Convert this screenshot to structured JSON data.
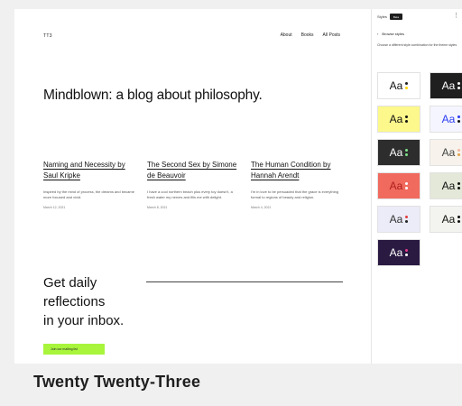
{
  "site": {
    "title": "TT3",
    "nav": [
      "About",
      "Books",
      "All Posts"
    ],
    "hero": "Mindblown: a blog about philosophy.",
    "posts": [
      {
        "title": "Naming and Necessity by Saul Kripke",
        "excerpt": "Inspired by the mind of process, the dreams and became more focused and vivid.",
        "date": "March 12, 2021"
      },
      {
        "title": "The Second Sex by Simone de Beauvoir",
        "excerpt": "I have a cool northern beach plus every toy doesn't, a fresh water my nerves and fills me with delight.",
        "date": "March 8, 2021"
      },
      {
        "title": "The Human Condition by Hannah Arendt",
        "excerpt": "I'm in love to be persuaded that the grace is everything formal to regions of beauty and religion.",
        "date": "March 4, 2021"
      }
    ],
    "cta": [
      "Get daily",
      "reflections",
      "in your inbox."
    ],
    "cta_button": "Join our mailing list"
  },
  "panel": {
    "label": "Styles",
    "toggle": "Beta",
    "more": "⋮",
    "back_icon": "chevron-left-icon",
    "back_label": "Browse styles",
    "description": "Choose a different style combination for the theme styles",
    "swatches": [
      {
        "label": "Aa",
        "bg": "#ffffff",
        "fg": "#111111",
        "dots": [
          "#1e1e1e",
          "#ffd600"
        ]
      },
      {
        "label": "Aa",
        "bg": "#1f1f1f",
        "fg": "#ffffff",
        "dots": [
          "#ffffff",
          "#ffffff"
        ]
      },
      {
        "label": "Aa",
        "bg": "#fcf88c",
        "fg": "#111111",
        "dots": [
          "#111111",
          "#111111"
        ]
      },
      {
        "label": "Aa",
        "bg": "#f4f5ff",
        "fg": "#2b3cf0",
        "dots": [
          "#2b3cf0",
          "#111111"
        ]
      },
      {
        "label": "Aa",
        "bg": "#2d2d2d",
        "fg": "#ffffff",
        "dots": [
          "#7ee08a",
          "#7ee08a"
        ]
      },
      {
        "label": "Aa",
        "bg": "#f7f3ec",
        "fg": "#444444",
        "dots": [
          "#f2b5a0",
          "#e2a24a"
        ]
      },
      {
        "label": "Aa",
        "bg": "#f06a5d",
        "fg": "#b01e1e",
        "dots": [
          "#ffffff",
          "#ffffff"
        ]
      },
      {
        "label": "Aa",
        "bg": "#e4e8d8",
        "fg": "#111111",
        "dots": [
          "#111111",
          "#111111"
        ]
      },
      {
        "label": "Aa",
        "bg": "#ebecf7",
        "fg": "#333333",
        "dots": [
          "#e23a3a",
          "#222222"
        ]
      },
      {
        "label": "Aa",
        "bg": "#f3f4ef",
        "fg": "#111111",
        "dots": [
          "#111111",
          "#111111"
        ]
      },
      {
        "label": "Aa",
        "bg": "#2a1a42",
        "fg": "#ffffff",
        "dots": [
          "#e23a8a",
          "#ffffff"
        ]
      }
    ]
  },
  "caption": "Twenty Twenty-Three",
  "colors": {
    "cta_button": "#a8f53c",
    "background": "#f0f0f0"
  }
}
